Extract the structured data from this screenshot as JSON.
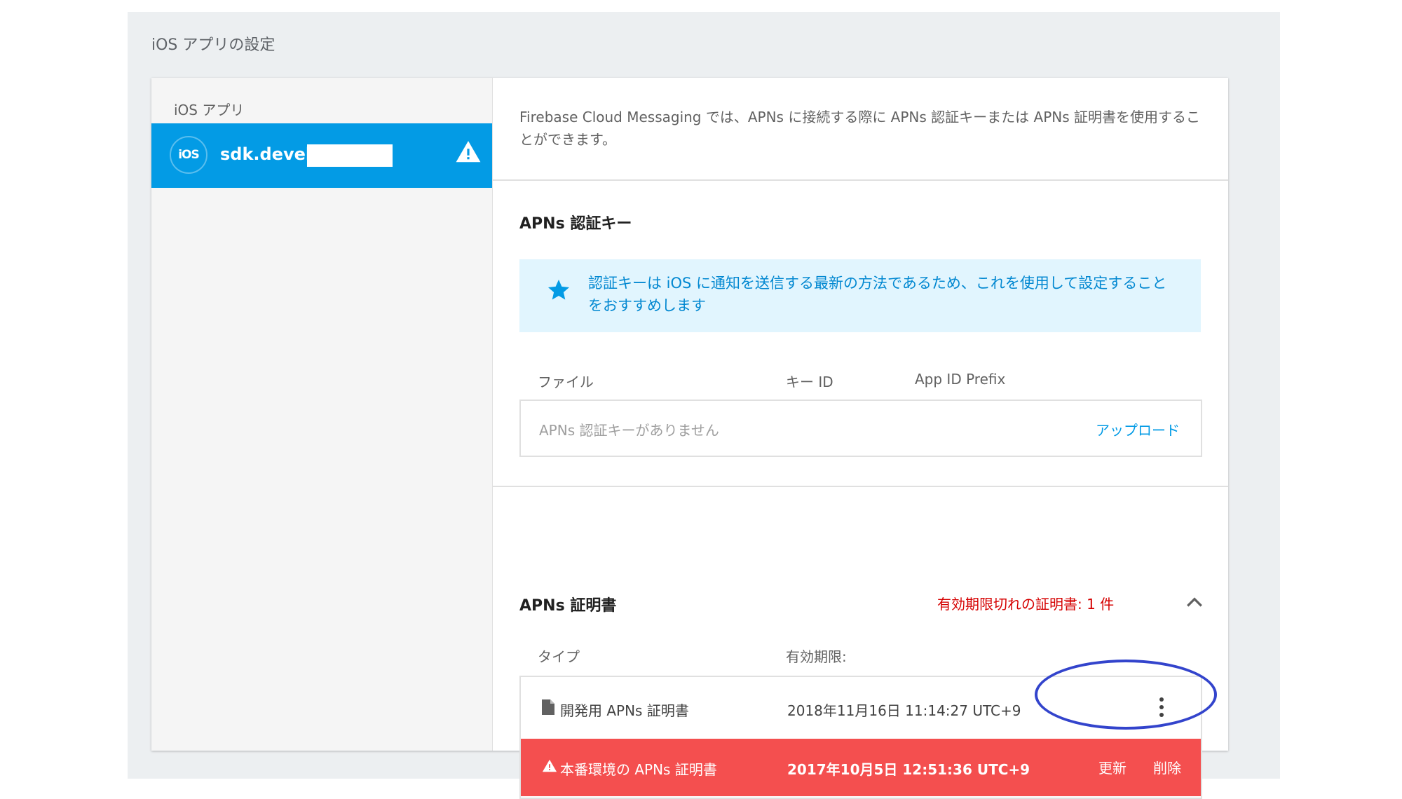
{
  "page": {
    "title": "iOS アプリの設定"
  },
  "sidebar": {
    "label": "iOS アプリ",
    "app": {
      "badge": "iOS",
      "name": "sdk.develop",
      "warning_icon": "warning-icon"
    }
  },
  "intro": "Firebase Cloud Messaging では、APNs に接続する際に APNs 認証キーまたは APNs 証明書を使用することができます。",
  "auth_key": {
    "heading": "APNs 認証キー",
    "info": "認証キーは iOS に通知を送信する最新の方法であるため、これを使用して設定することをおすすめします",
    "info_icon": "star-icon",
    "columns": [
      "ファイル",
      "キー ID",
      "App ID Prefix"
    ],
    "empty": "APNs 認証キーがありません",
    "upload": "アップロード"
  },
  "certificates": {
    "heading": "APNs 証明書",
    "expired_notice": "有効期限切れの証明書: 1 件",
    "columns": [
      "タイプ",
      "有効期限:"
    ],
    "rows": [
      {
        "type": "開発用 APNs 証明書",
        "expires": "2018年11月16日 11:14:27 UTC+9",
        "icon": "file-icon"
      },
      {
        "type": "本番環境の APNs 証明書",
        "expires": "2017年10月5日 12:51:36 UTC+9",
        "icon": "warning-icon",
        "renew": "更新",
        "delete": "削除"
      }
    ]
  },
  "colors": {
    "accent": "#039be5",
    "danger": "#f44f4f",
    "info_bg": "#e1f5fe",
    "expired_text": "#d50000",
    "annotation": "#3344cc"
  }
}
